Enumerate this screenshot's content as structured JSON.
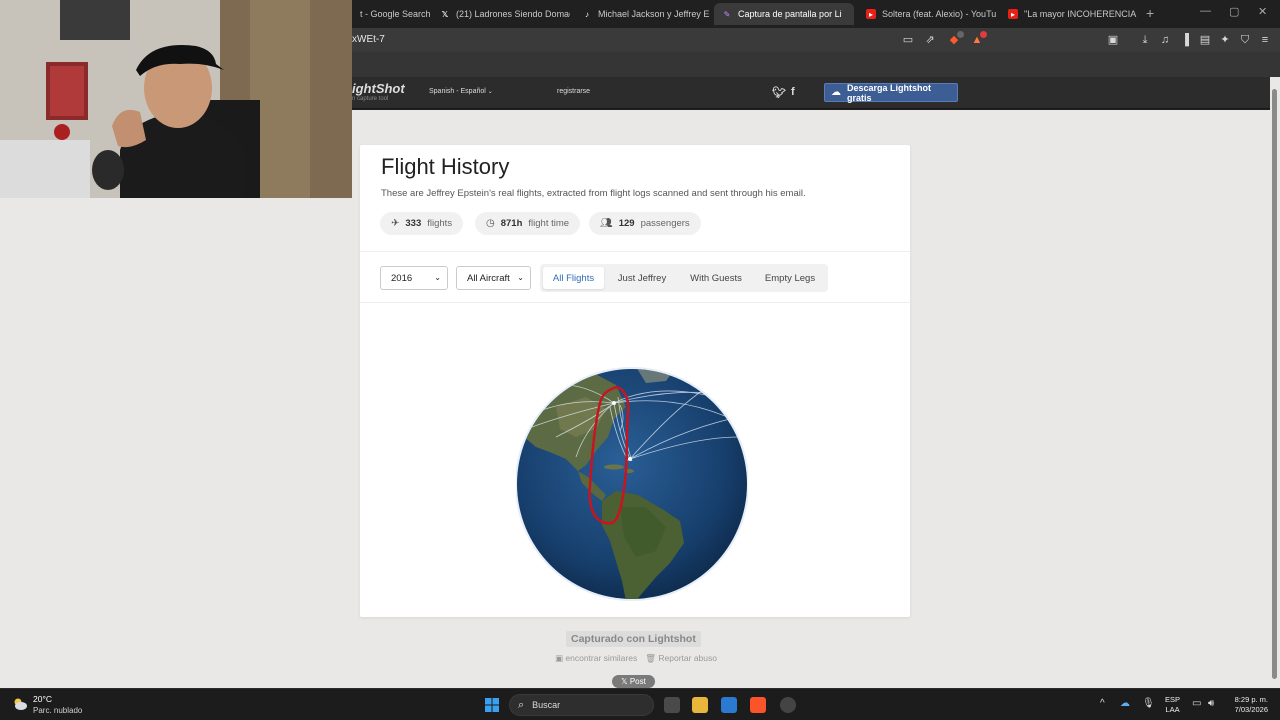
{
  "browser": {
    "tabs": [
      {
        "label": "t - Google Search",
        "favicon": "google-icon"
      },
      {
        "label": "(21) Ladrones Siendo Domad",
        "favicon": "x-icon"
      },
      {
        "label": "Michael Jackson y Jeffrey Epste",
        "favicon": "tiktok-icon"
      },
      {
        "label": "Captura de pantalla por Li",
        "favicon": "lightshot-icon",
        "active": true
      },
      {
        "label": "Soltera (feat. Alexio) - YouTube",
        "favicon": "youtube-icon"
      },
      {
        "label": "\"La mayor INCOHERENCIA de",
        "favicon": "youtube-icon"
      }
    ],
    "url": "xWEt-7",
    "badge_counts": {
      "brave": "8",
      "rewards": "1"
    }
  },
  "lightshot": {
    "logo": "ightShot",
    "tagline": "n capture tool",
    "language": "Spanish - Español",
    "register": "registrarse",
    "download": "Descarga Lightshot gratis",
    "captured": "Capturado con Lightshot",
    "find_similar": "encontrar similares",
    "report": "Reportar abuso",
    "post": "Post"
  },
  "card": {
    "title": "Flight History",
    "description": "These are Jeffrey Epstein's real flights, extracted from flight logs scanned and sent through his email.",
    "stats": [
      {
        "icon": "airplane-icon",
        "value": "333",
        "label": "flights"
      },
      {
        "icon": "clock-icon",
        "value": "871h",
        "label": "flight time"
      },
      {
        "icon": "people-icon",
        "value": "129",
        "label": "passengers"
      }
    ],
    "year": "2016",
    "aircraft": "All Aircraft",
    "filters": [
      "All Flights",
      "Just Jeffrey",
      "With Guests",
      "Empty Legs"
    ],
    "active_filter": "All Flights",
    "accent": "#2f6fb8"
  },
  "taskbar": {
    "temperature": "20°C",
    "weather": "Parc. nublado",
    "search_label": "Buscar",
    "lang_top": "ESP",
    "lang_bottom": "LAA",
    "time": "8:29 p. m.",
    "date": "7/03/2026"
  }
}
